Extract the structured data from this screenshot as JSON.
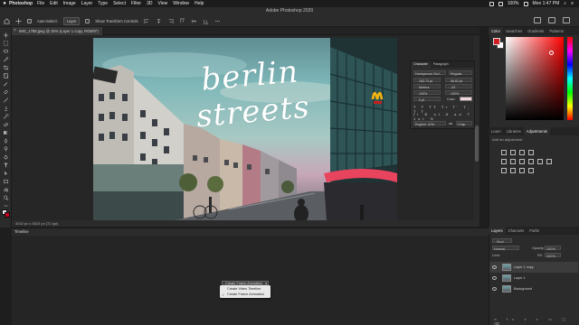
{
  "menubar": {
    "app": "Photoshop",
    "items": [
      "File",
      "Edit",
      "Image",
      "Layer",
      "Type",
      "Select",
      "Filter",
      "3D",
      "View",
      "Window",
      "Help"
    ],
    "battery": "100%",
    "clock": "Mon 1:47 PM"
  },
  "window": {
    "title": "Adobe Photoshop 2020"
  },
  "options": {
    "autoselect_label": "Auto-Select:",
    "layer_dropdown": "Layer",
    "transform_label": "Show Transform Controls"
  },
  "document": {
    "tab_title": "IMG_1788.jpeg @ 25% (Layer 1 copy, RGB/8*)",
    "close_glyph": "×",
    "status": "4032 px x 3024 px (72 ppi)"
  },
  "photo": {
    "script_text": "berlin streets",
    "colors": {
      "sky_top": "#5f8d92",
      "sky_mid": "#a8c9c3",
      "mcdonalds": "#f5b50f"
    }
  },
  "character_panel": {
    "tabs": [
      "Character",
      "Paragraph"
    ],
    "font_family": "Honeymoon Scri...",
    "font_style": "Regular",
    "size": "183.73 pt",
    "leading": "96.62 pt",
    "tracking_label": "Metrics",
    "tracking_value": "-20",
    "vscale": "100%",
    "hscale": "100%",
    "baseline": "0 pt",
    "color_label": "Color:",
    "language": "English: USA",
    "aa_label": "aa",
    "aa_value": "Crisp"
  },
  "color_panel": {
    "tabs": [
      "Color",
      "Swatches",
      "Gradients",
      "Patterns"
    ],
    "fg": "#d21d22",
    "bg": "#ffffff"
  },
  "adjust_panel": {
    "tabs": [
      "Learn",
      "Libraries",
      "Adjustments"
    ],
    "hint": "Add an adjustment"
  },
  "layers_panel": {
    "tabs": [
      "Layers",
      "Channels",
      "Paths"
    ],
    "kind_label": "Kind",
    "blend_mode": "Normal",
    "opacity_label": "Opacity:",
    "opacity_value": "100%",
    "lock_label": "Lock:",
    "fill_label": "Fill:",
    "fill_value": "100%",
    "layers": [
      {
        "name": "Layer 1 copy",
        "selected": true
      },
      {
        "name": "Layer 1",
        "selected": false
      },
      {
        "name": "Background",
        "selected": false
      }
    ]
  },
  "timeline": {
    "title": "Timeline",
    "button_label": "Create Frame Animation",
    "menu": [
      {
        "label": "Create Video Timeline",
        "checked": false
      },
      {
        "label": "Create Frame Animation",
        "checked": true
      }
    ],
    "check_glyph": "✓"
  }
}
